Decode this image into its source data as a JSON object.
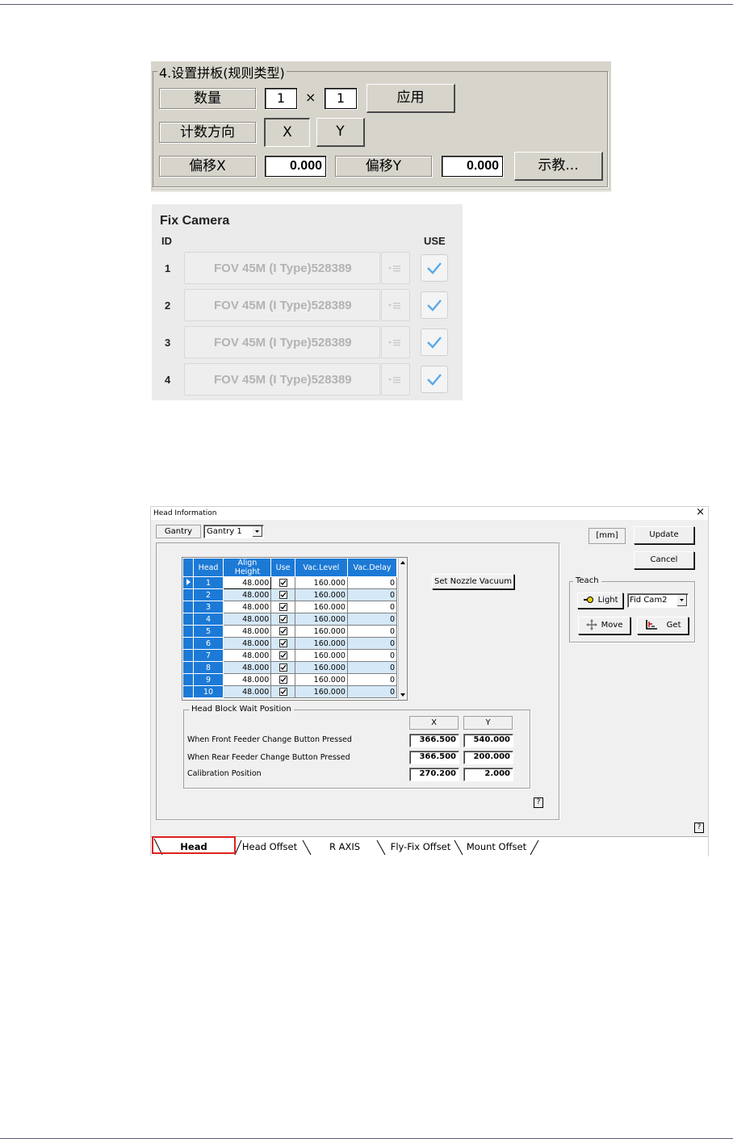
{
  "panel1": {
    "group_title": "4.设置拼板(规则类型)",
    "quantity_label": "数量",
    "quantity_x": "1",
    "times_sign": "×",
    "quantity_y": "1",
    "apply_button": "应用",
    "count_direction_label": "计数方向",
    "dir_x_button": "X",
    "dir_y_button": "Y",
    "offset_x_label": "偏移X",
    "offset_x_value": "0.000",
    "offset_y_label": "偏移Y",
    "offset_y_value": "0.000",
    "teach_button": "示教..."
  },
  "fix_camera": {
    "title": "Fix Camera",
    "col_id": "ID",
    "col_use": "USE",
    "rows": [
      {
        "id": "1",
        "camera": "FOV 45M (I Type)528389",
        "use": true
      },
      {
        "id": "2",
        "camera": "FOV 45M (I Type)528389",
        "use": true
      },
      {
        "id": "3",
        "camera": "FOV 45M (I Type)528389",
        "use": true
      },
      {
        "id": "4",
        "camera": "FOV 45M (I Type)528389",
        "use": true
      }
    ]
  },
  "head_info": {
    "window_title": "Head Information",
    "close_glyph": "×",
    "gantry_label": "Gantry",
    "gantry_value": "Gantry 1",
    "unit_label": "[mm]",
    "update_button": "Update",
    "cancel_button": "Cancel",
    "teach_group": "Teach",
    "light_button": "Light",
    "camera_select": "Fid Cam2",
    "move_button": "Move",
    "get_button": "Get",
    "set_nozzle_button": "Set Nozzle Vacuum",
    "help_glyph": "?",
    "grid": {
      "headers": [
        "Head",
        "Align Height",
        "Use",
        "Vac.Level",
        "Vac.Delay"
      ],
      "rows": [
        {
          "head": "1",
          "align": "48.000",
          "use": true,
          "vac_level": "160.000",
          "vac_delay": "0"
        },
        {
          "head": "2",
          "align": "48.000",
          "use": true,
          "vac_level": "160.000",
          "vac_delay": "0"
        },
        {
          "head": "3",
          "align": "48.000",
          "use": true,
          "vac_level": "160.000",
          "vac_delay": "0"
        },
        {
          "head": "4",
          "align": "48.000",
          "use": true,
          "vac_level": "160.000",
          "vac_delay": "0"
        },
        {
          "head": "5",
          "align": "48.000",
          "use": true,
          "vac_level": "160.000",
          "vac_delay": "0"
        },
        {
          "head": "6",
          "align": "48.000",
          "use": true,
          "vac_level": "160.000",
          "vac_delay": "0"
        },
        {
          "head": "7",
          "align": "48.000",
          "use": true,
          "vac_level": "160.000",
          "vac_delay": "0"
        },
        {
          "head": "8",
          "align": "48.000",
          "use": true,
          "vac_level": "160.000",
          "vac_delay": "0"
        },
        {
          "head": "9",
          "align": "48.000",
          "use": true,
          "vac_level": "160.000",
          "vac_delay": "0"
        },
        {
          "head": "10",
          "align": "48.000",
          "use": true,
          "vac_level": "160.000",
          "vac_delay": "0"
        }
      ]
    },
    "wait_group": {
      "title": "Head Block Wait Position",
      "col_x": "X",
      "col_y": "Y",
      "rows": [
        {
          "label": "When Front Feeder Change Button Pressed",
          "x": "366.500",
          "y": "540.000"
        },
        {
          "label": "When Rear Feeder Change Button Pressed",
          "x": "366.500",
          "y": "200.000"
        },
        {
          "label": "Calibration Position",
          "x": "270.200",
          "y": "2.000"
        }
      ]
    },
    "tabs": [
      "Head",
      "Head Offset",
      "R AXIS",
      "Fly-Fix Offset",
      "Mount Offset"
    ],
    "active_tab": "Head",
    "active_tab_color": "#e02020",
    "grid_header_color": "#1c7ad6",
    "grid_alt_row_color": "#d5e8f7"
  }
}
